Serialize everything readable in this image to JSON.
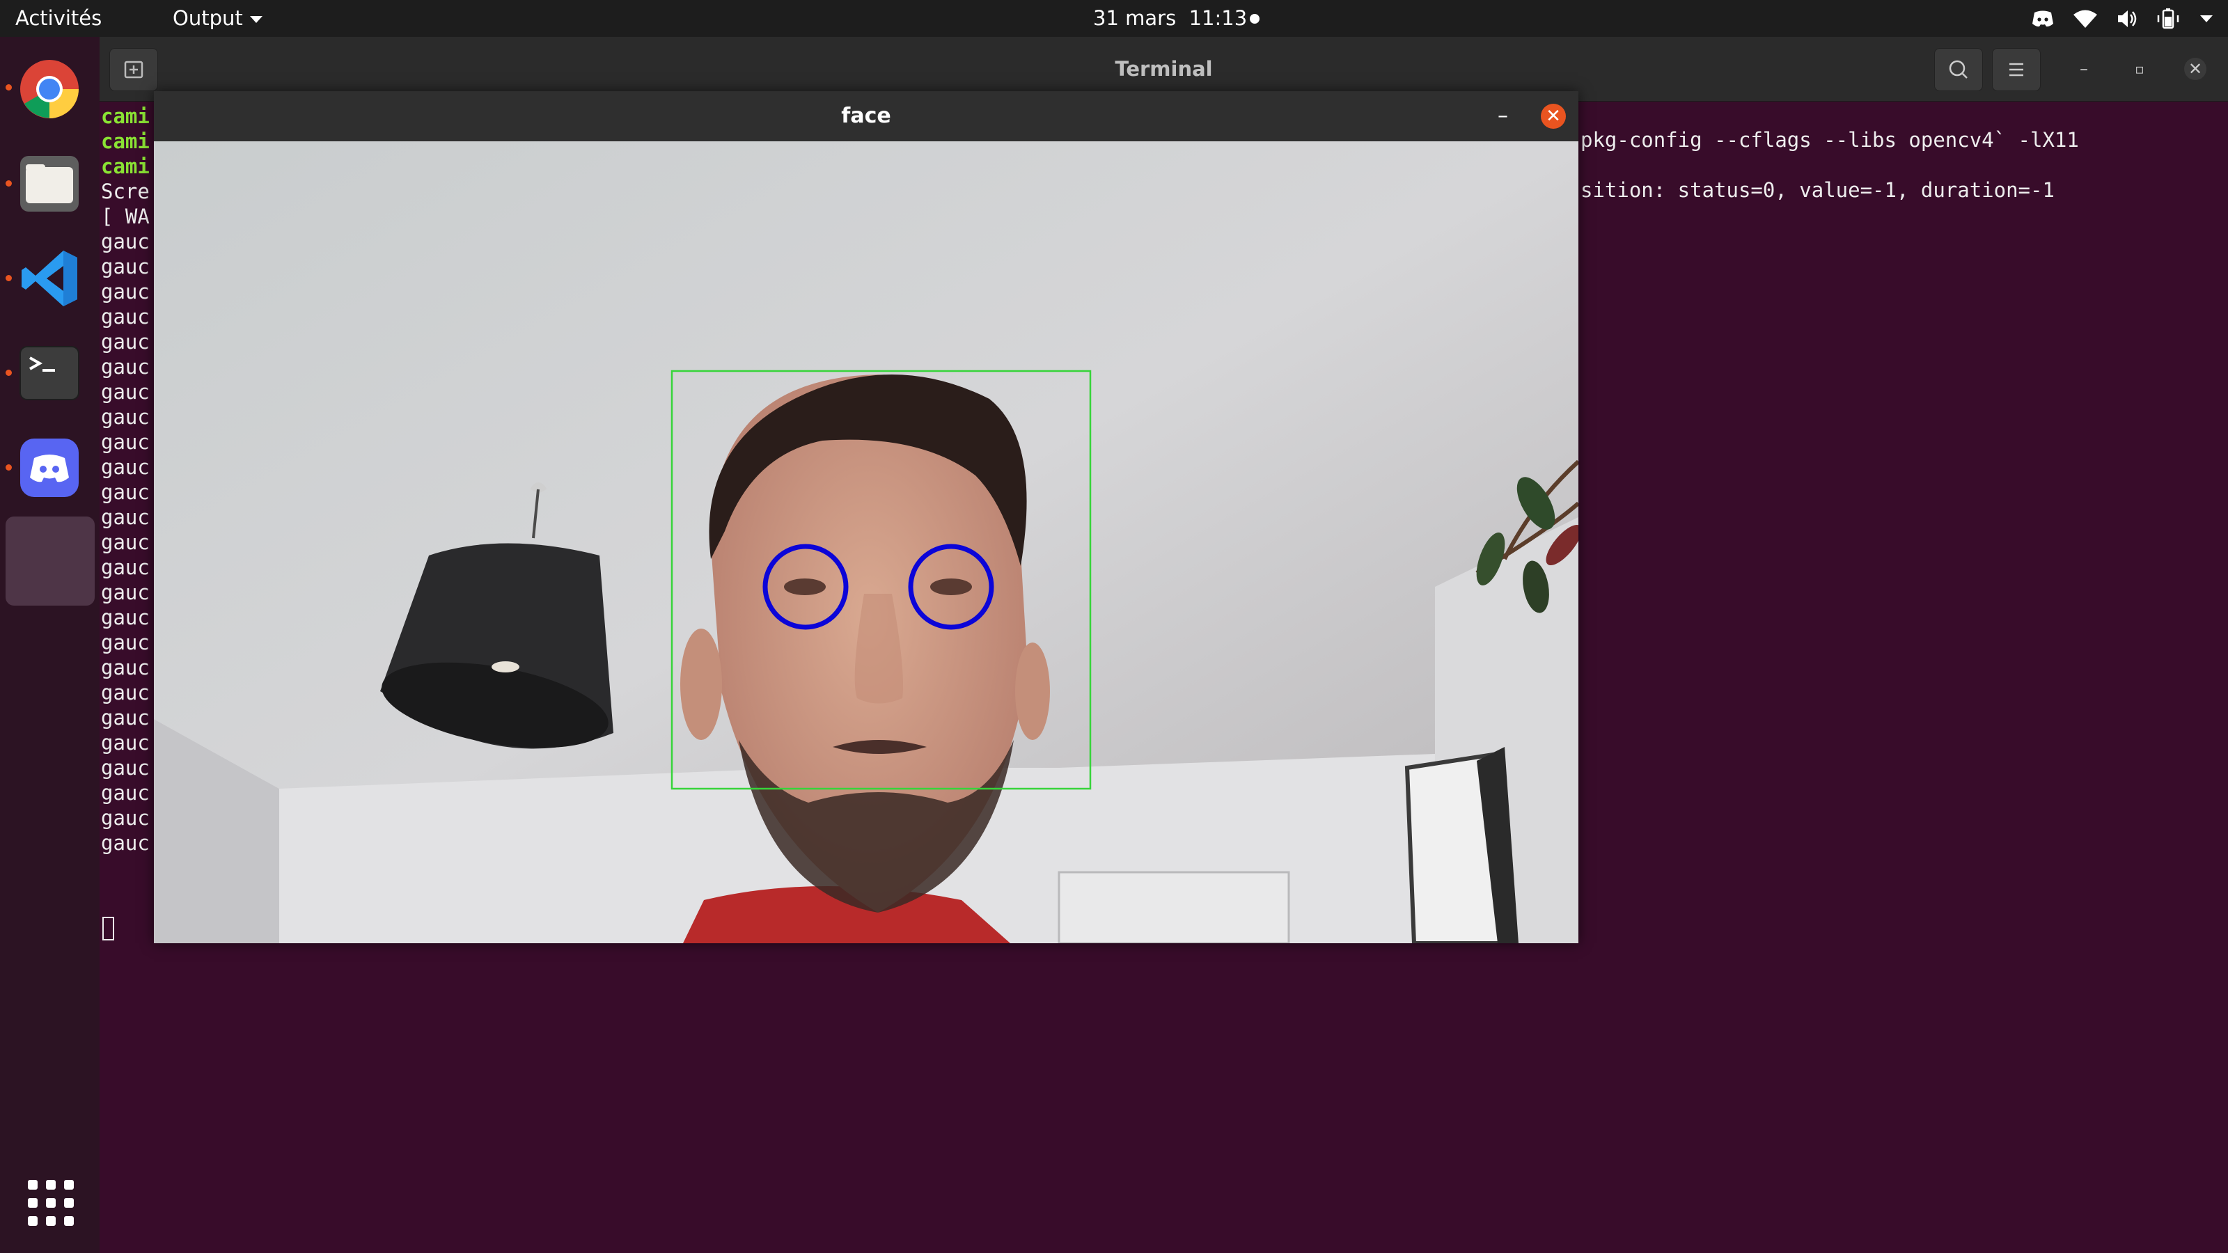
{
  "topbar": {
    "activities": "Activités",
    "app_menu": "Output",
    "date": "31 mars",
    "time": "11:13",
    "icons": [
      "discord-icon",
      "wifi-icon",
      "volume-icon",
      "battery-icon",
      "chevron-down-icon"
    ]
  },
  "dock": {
    "items": [
      "chrome",
      "files",
      "vscode",
      "terminal",
      "discord",
      "empty-window"
    ],
    "apps_grid_icon": "show-applications-icon"
  },
  "terminal": {
    "title": "Terminal",
    "lines_left": [
      "cami",
      "cami",
      "cami",
      "Scre",
      "[ WA",
      "gauc",
      "gauc",
      "gauc",
      "gauc",
      "gauc",
      "gauc",
      "gauc",
      "gauc",
      "gauc",
      "gauc",
      "gauc",
      "gauc",
      "gauc",
      "gauc",
      "gauc",
      "gauc",
      "gauc",
      "gauc",
      "gauc",
      "gauc",
      "gauc",
      "gauc",
      "gauc",
      "gauc",
      "gauc"
    ],
    "right_line_1": "pkg-config --cflags --libs opencv4` -lX11",
    "right_line_2": "sition: status=0, value=-1, duration=-1"
  },
  "face_window": {
    "title": "face",
    "minimize": "–",
    "close": "✕"
  },
  "colors": {
    "terminal_bg": "#380c2a",
    "prompt_green": "#8ae234",
    "face_box": "#37d43a",
    "eye_circle": "#0b05d8",
    "ubuntu_orange": "#e95420"
  }
}
